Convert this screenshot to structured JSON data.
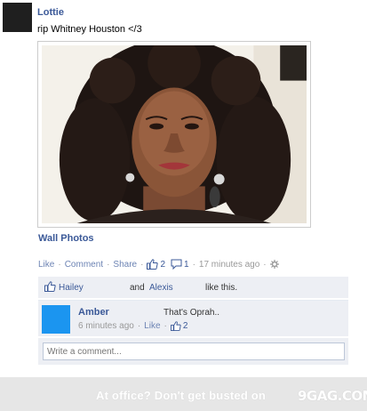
{
  "post": {
    "author": "Lottie",
    "status": "rip Whitney Houston </3",
    "album_link": "Wall Photos"
  },
  "actions": {
    "like": "Like",
    "comment": "Comment",
    "share": "Share",
    "likes_count": "2",
    "comments_count": "1",
    "time": "17 minutes ago"
  },
  "likes_bar": {
    "liker1": "Hailey",
    "and": "and",
    "liker2": "Alexis",
    "suffix": "like this."
  },
  "comment": {
    "author": "Amber",
    "text": "That's Oprah..",
    "time": "6 minutes ago",
    "like": "Like",
    "likes_count": "2"
  },
  "write_comment": {
    "placeholder": "Write a comment..."
  },
  "footer": {
    "tagline": "At office? Don't get busted on",
    "logo": "9GAG.COM"
  },
  "colors": {
    "link": "#3b5998",
    "panel": "#edeff4",
    "comment_avatar": "#1b95f0"
  },
  "icons": [
    "thumbs-up-icon",
    "speech-bubble-icon",
    "settings-gear-icon"
  ]
}
